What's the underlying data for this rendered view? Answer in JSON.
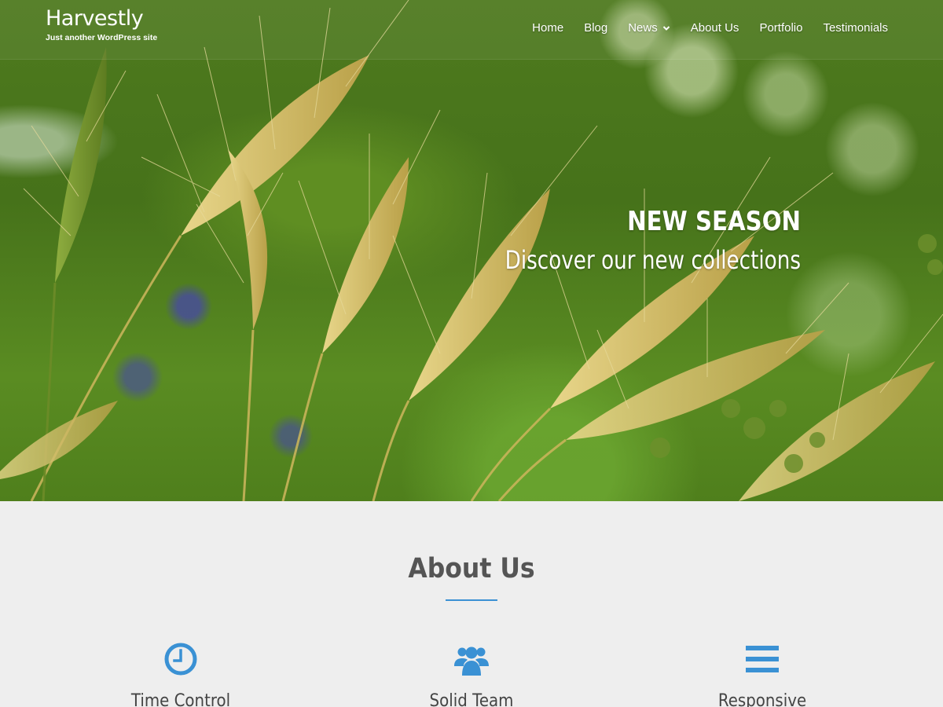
{
  "site": {
    "title": "Harvestly",
    "tagline": "Just another WordPress site"
  },
  "nav": {
    "items": [
      {
        "label": "Home",
        "has_dropdown": false
      },
      {
        "label": "Blog",
        "has_dropdown": false
      },
      {
        "label": "News",
        "has_dropdown": true
      },
      {
        "label": "About Us",
        "has_dropdown": false
      },
      {
        "label": "Portfolio",
        "has_dropdown": false
      },
      {
        "label": "Testimonials",
        "has_dropdown": false
      }
    ]
  },
  "hero": {
    "title": "NEW SEASON",
    "subtitle": "Discover our new collections",
    "image": "wheat-field-photo"
  },
  "about": {
    "title": "About Us",
    "features": [
      {
        "icon": "clock-icon",
        "label": "Time Control"
      },
      {
        "icon": "users-icon",
        "label": "Solid Team"
      },
      {
        "icon": "bars-icon",
        "label": "Responsive"
      }
    ]
  },
  "colors": {
    "accent": "#3a91d4",
    "heading": "#555555",
    "section_bg": "#eeeeee"
  }
}
